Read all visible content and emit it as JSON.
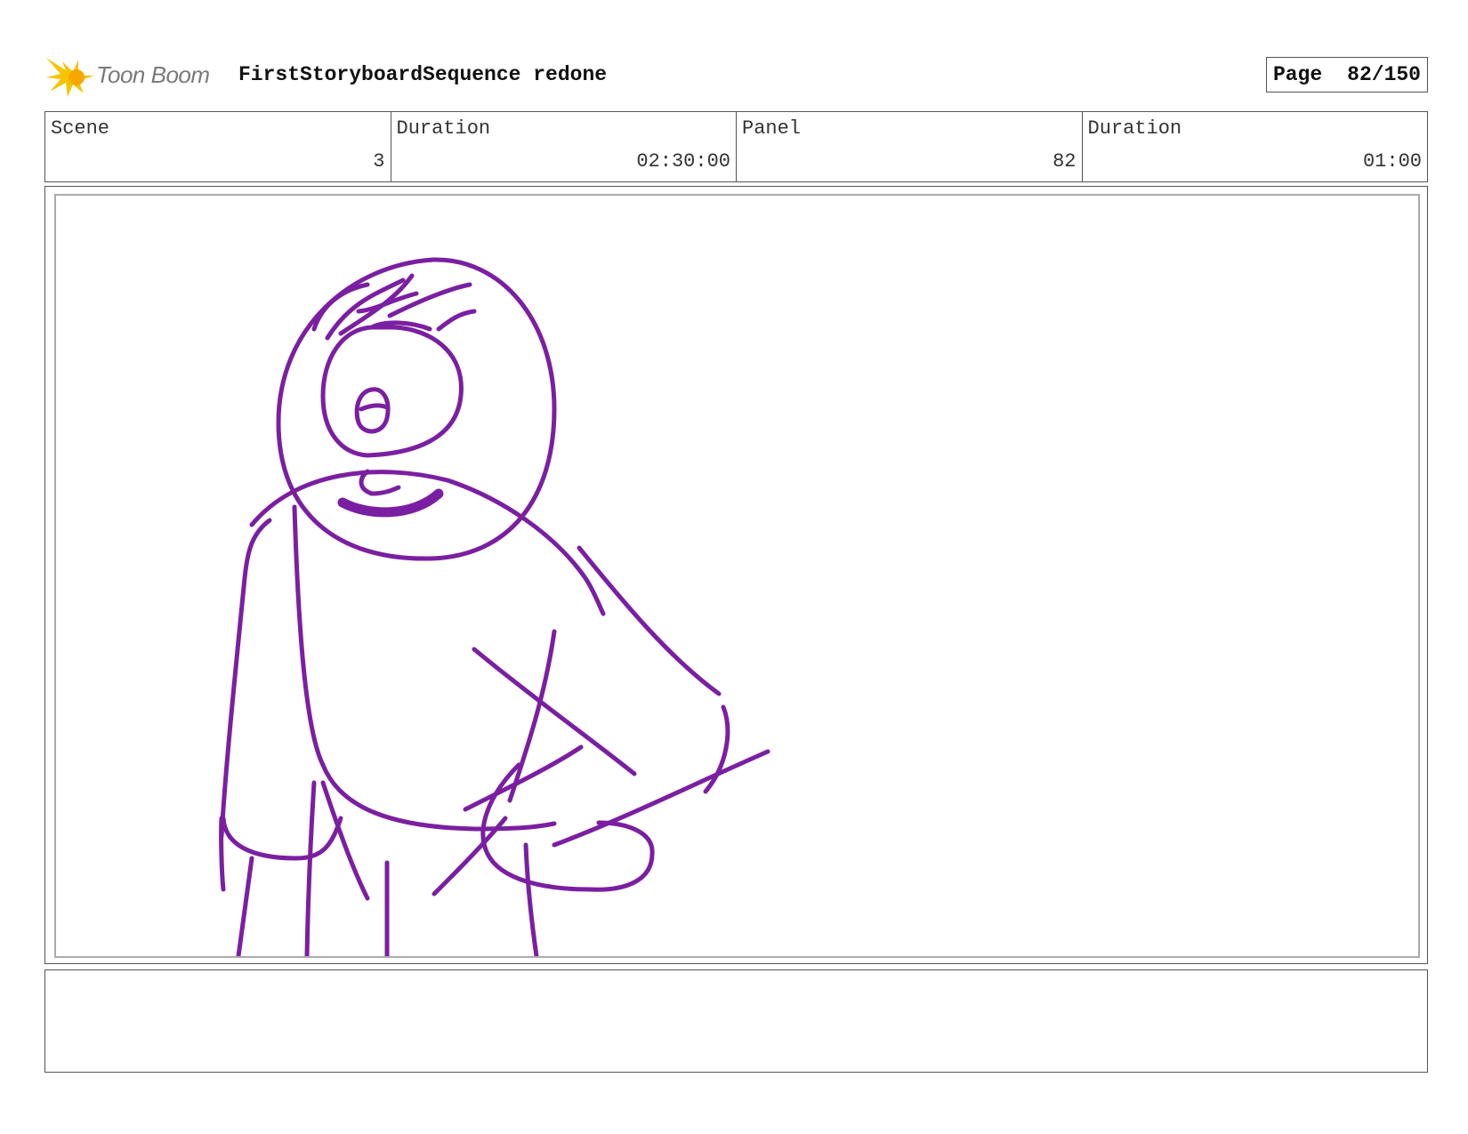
{
  "header": {
    "logo_text": "Toon Boom",
    "title": "FirstStoryboardSequence redone",
    "page_label": "Page",
    "page_value": "82/150"
  },
  "info": [
    {
      "label": "Scene",
      "value": "3"
    },
    {
      "label": "Duration",
      "value": "02:30:00"
    },
    {
      "label": "Panel",
      "value": "82"
    },
    {
      "label": "Duration",
      "value": "01:00"
    }
  ],
  "notes": {
    "text": ""
  },
  "colors": {
    "sketch": "#7b1fa2",
    "logo_yellow": "#f5c400"
  },
  "icons": {
    "logo": "toon-boom-star-icon"
  }
}
